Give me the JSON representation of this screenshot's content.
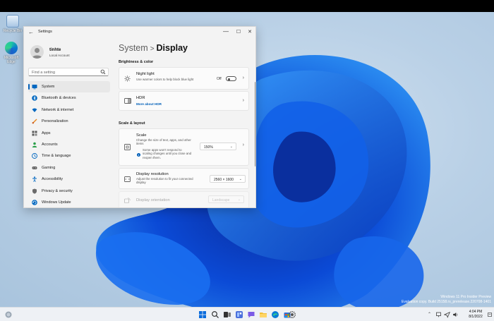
{
  "desktop": {
    "icons": [
      {
        "label": "Recycle Bin"
      },
      {
        "label": "Microsoft Edge"
      }
    ],
    "watermark": {
      "line1": "Windows 11 Pro Insider Preview",
      "line2": "Evaluation copy. Build 25158.rs_prerelease.220708-1401"
    }
  },
  "window": {
    "title": "Settings",
    "controls": {
      "minimize": "—",
      "maximize": "☐",
      "close": "✕"
    },
    "back": "←"
  },
  "profile": {
    "name": "tinhte",
    "account": "Local Account"
  },
  "search": {
    "placeholder": "Find a setting"
  },
  "nav": [
    {
      "label": "System",
      "icon": "display-icon",
      "color": "#0067c0"
    },
    {
      "label": "Bluetooth & devices",
      "icon": "bluetooth-icon",
      "color": "#0067c0"
    },
    {
      "label": "Network & internet",
      "icon": "wifi-icon",
      "color": "#0067c0"
    },
    {
      "label": "Personalization",
      "icon": "brush-icon",
      "color": "#e8871e"
    },
    {
      "label": "Apps",
      "icon": "apps-icon",
      "color": "#5a5a5a"
    },
    {
      "label": "Accounts",
      "icon": "person-icon",
      "color": "#2aa04a"
    },
    {
      "label": "Time & language",
      "icon": "globe-clock-icon",
      "color": "#0067c0"
    },
    {
      "label": "Gaming",
      "icon": "gamepad-icon",
      "color": "#5a5a5a"
    },
    {
      "label": "Accessibility",
      "icon": "accessibility-icon",
      "color": "#0067c0"
    },
    {
      "label": "Privacy & security",
      "icon": "shield-icon",
      "color": "#6b6b6b"
    },
    {
      "label": "Windows Update",
      "icon": "update-icon",
      "color": "#0067c0"
    }
  ],
  "breadcrumb": {
    "parent": "System",
    "separator": ">",
    "current": "Display"
  },
  "sections": {
    "brightness": "Brightness & color",
    "scale": "Scale & layout"
  },
  "cards": {
    "night_light": {
      "title": "Night light",
      "subtitle": "Use warmer colors to help block blue light",
      "state_label": "Off"
    },
    "hdr": {
      "title": "HDR",
      "link": "More about HDR"
    },
    "scale": {
      "title": "Scale",
      "subtitle": "Change the size of text, apps, and other items",
      "warning": "Some apps won't respond to scaling changes until you close and reopen them.",
      "value": "150%"
    },
    "resolution": {
      "title": "Display resolution",
      "subtitle": "Adjust the resolution to fit your connected display",
      "value": "2560 × 1600"
    },
    "orientation": {
      "title": "Display orientation",
      "value": "Landscape"
    }
  },
  "taskbar": {
    "clock": {
      "time": "4:04 PM",
      "date": "8/1/2022"
    }
  },
  "colors": {
    "accent": "#005fb8",
    "taskbar": "#eef1f5"
  }
}
